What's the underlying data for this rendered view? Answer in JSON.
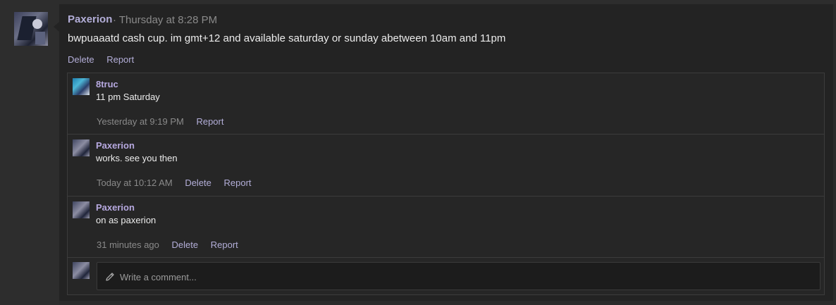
{
  "post": {
    "author": "Paxerion",
    "time": "· Thursday at 8:28 PM",
    "text": "bwpuaaatd cash cup. im gmt+12 and available saturday or sunday abetween 10am and 11pm",
    "actions": {
      "delete": "Delete",
      "report": "Report"
    }
  },
  "comments": [
    {
      "author": "8truc",
      "text": "11 pm Saturday",
      "time": "Yesterday at 9:19 PM",
      "report": "Report"
    },
    {
      "author": "Paxerion",
      "text": "works. see you then",
      "time": "Today at 10:12 AM",
      "delete": "Delete",
      "report": "Report"
    },
    {
      "author": "Paxerion",
      "text": "on as paxerion",
      "time": "31 minutes ago",
      "delete": "Delete",
      "report": "Report"
    }
  ],
  "composer": {
    "placeholder": "Write a comment..."
  },
  "icons": {
    "edit": "pencil-icon"
  },
  "colors": {
    "author": "#b7a9e0",
    "link": "#b3aed8",
    "muted": "#8a8a8a",
    "background": "#232323"
  }
}
